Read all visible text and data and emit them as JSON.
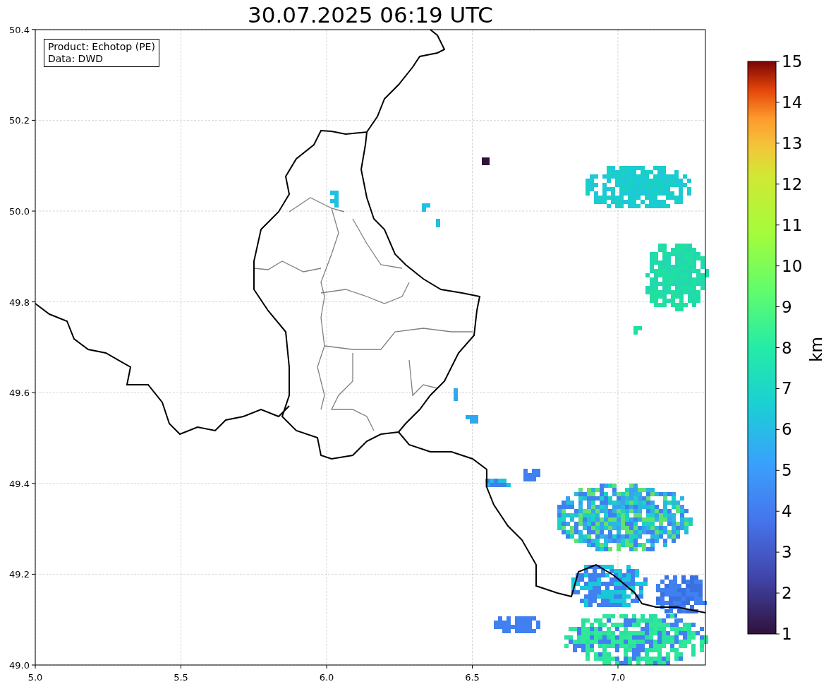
{
  "title": "30.07.2025 06:19 UTC",
  "info_box": [
    "Product: Echotop (PE)",
    "Data: DWD"
  ],
  "map": {
    "xticks": [
      "5.0",
      "5.5",
      "6.0",
      "6.5",
      "7.0"
    ],
    "yticks": [
      "50.4",
      "50.2",
      "50.0",
      "49.8",
      "49.6",
      "49.4",
      "49.2",
      "49.0"
    ]
  },
  "colorbar": {
    "label": "km",
    "ticks": [
      "15",
      "14",
      "13",
      "12",
      "11",
      "10",
      "9",
      "8",
      "7",
      "6",
      "5",
      "4",
      "3",
      "2",
      "1"
    ]
  }
}
